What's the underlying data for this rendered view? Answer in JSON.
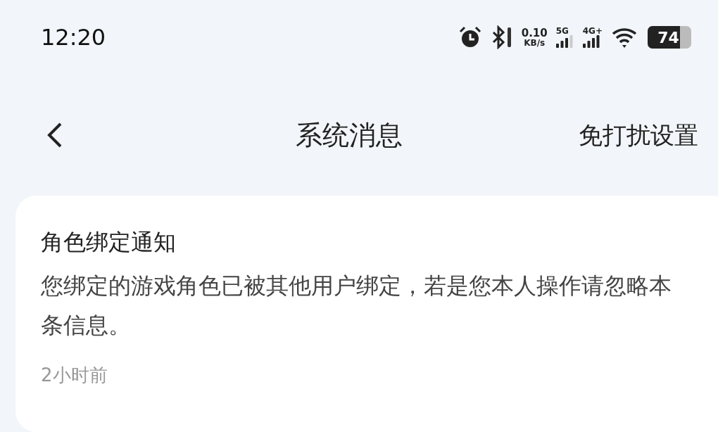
{
  "status_bar": {
    "time": "12:20",
    "speed_value": "0.10",
    "speed_unit": "KB/s",
    "network_1": "5G",
    "network_2": "4G+",
    "battery": "74"
  },
  "nav": {
    "title": "系统消息",
    "action": "免打扰设置"
  },
  "messages": [
    {
      "title": "角色绑定通知",
      "body": "您绑定的游戏角色已被其他用户绑定，若是您本人操作请忽略本条信息。",
      "time": "2小时前"
    }
  ]
}
